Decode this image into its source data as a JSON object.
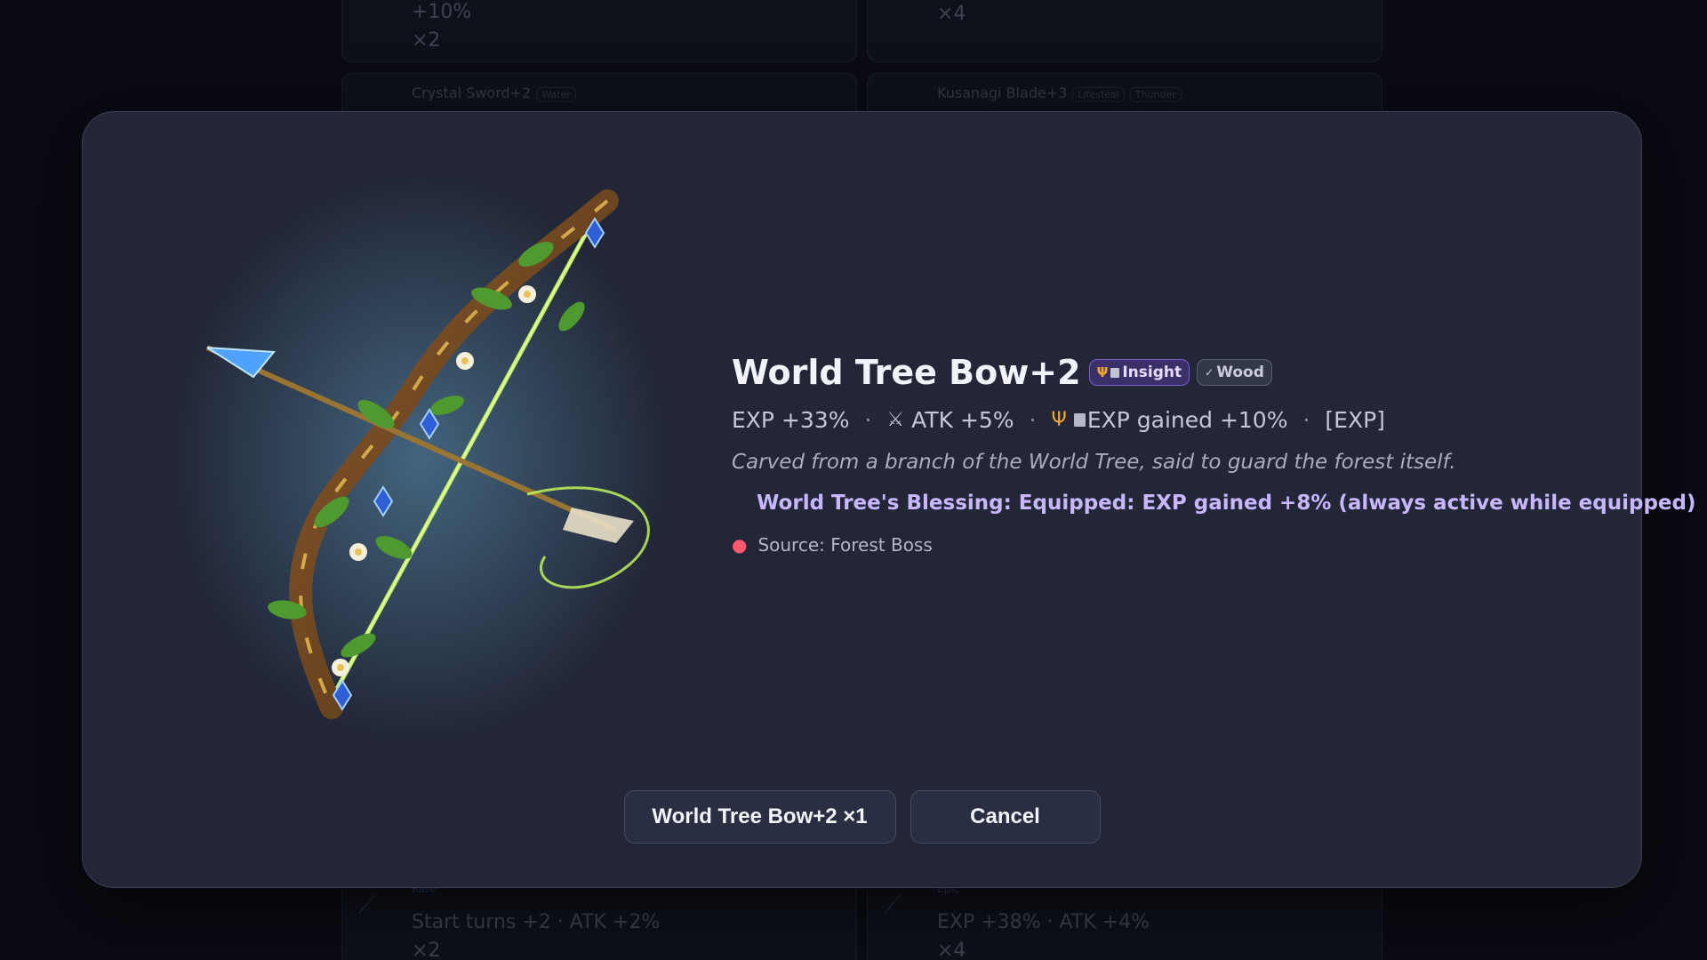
{
  "background": {
    "cards": [
      {
        "name": "",
        "line1": "+10%",
        "line2": "×2"
      },
      {
        "name": "",
        "line1": "×4",
        "line2": ""
      },
      {
        "name": "Crystal Sword+2",
        "tags": [
          "Water"
        ]
      },
      {
        "name": "Kusanagi Blade+3",
        "tags": [
          "Lifesteal",
          "Thunder"
        ]
      },
      {
        "rarity": "Rare",
        "line1": "Start turns +2 · ATK +2%",
        "line2": "×2"
      },
      {
        "rarity": "Epic",
        "line1": "EXP +38% · ATK +4%",
        "line2": "×4"
      }
    ]
  },
  "modal": {
    "title": "World Tree Bow+2",
    "badges": [
      {
        "label": "Insight",
        "icon": "trident-icon"
      },
      {
        "label": "Wood",
        "icon": "leaf-icon"
      }
    ],
    "stats": {
      "exp": "EXP +33%",
      "atk": "ATK +5%",
      "exp_gained": "EXP gained +10%",
      "tag": "[EXP]"
    },
    "description": "Carved from a branch of the World Tree, said to guard the forest itself.",
    "blessing": "World Tree's Blessing: Equipped: EXP gained +8% (always active while equipped)",
    "source": "Source: Forest Boss",
    "buttons": {
      "confirm": "World Tree Bow+2 ×1",
      "cancel": "Cancel"
    }
  },
  "colors": {
    "modal_bg": "#222637",
    "insight_badge": "#3b2f6a",
    "blessing_text": "#c8b6ff",
    "gold_icon": "#f0a531"
  }
}
